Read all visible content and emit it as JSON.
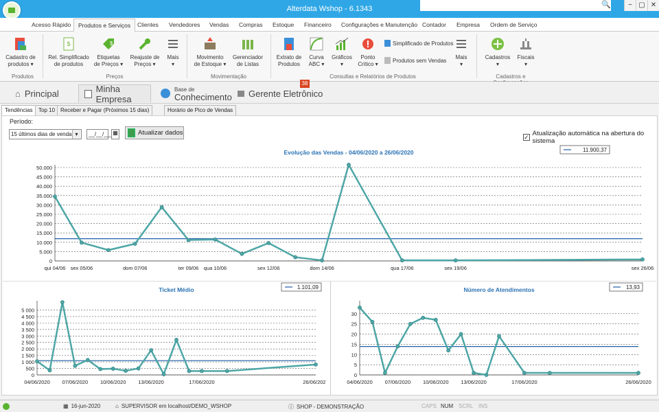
{
  "window": {
    "title": "Alterdata Wshop - 6.1343",
    "buttons": [
      "−",
      "▢",
      "✕"
    ]
  },
  "ribbon_tabs": [
    "Acesso Rápido",
    "Produtos e Serviços",
    "Clientes",
    "Vendedores",
    "Vendas",
    "Compras",
    "Estoque",
    "Financeiro",
    "Configurações e Manutenção",
    "Contador",
    "Empresa",
    "Ordem de Serviço"
  ],
  "ribbon": {
    "cadastro_produtos": "Cadastro de\nprodutos ▾",
    "rel_simplificado": "Rel. Simplificado\nde produtos",
    "etiquetas": "Etiquetas\nde Preços ▾",
    "reajuste": "Reajuste de\nPreços ▾",
    "mais1": "Mais\n▾",
    "movimento": "Movimento\nde Estoque ▾",
    "gerenciador": "Gerenciador\nde Listas",
    "extrato": "Extrato de\nProdutos",
    "curva": "Curva\nABC ▾",
    "graficos": "Gráficos\n▾",
    "ponto_critico": "Ponto\nCrítico ▾",
    "simplificado_produtos": "Simplificado de Produtos",
    "produtos_sem_vendas": "Produtos sem Vendas",
    "mais2": "Mais\n▾",
    "cadastros": "Cadastros\n▾",
    "fiscais": "Fiscais\n▾",
    "groups": [
      "Produtos",
      "Preços",
      "Movimentação",
      "Consultas e Relatórios de Produtos",
      "Cadastros e Configurações"
    ]
  },
  "nav": {
    "principal": "Principal",
    "minha_empresa": "Minha Empresa",
    "base_small": "Base de",
    "base_big": "Conhecimento",
    "gerente": "Gerente Eletrônico",
    "badge": "38"
  },
  "subtabs": [
    "Tendências",
    "Top 10",
    "Receber e Pagar (Próximos 15 dias)",
    "Horário de Pico de Vendas"
  ],
  "filters": {
    "periodo_label": "Período:",
    "periodo_value": "15 últimos dias de vendas",
    "date_value": "__/__/____",
    "update_button": "Atualizar dados",
    "auto_update": "Atualização automática na abertura do sistema"
  },
  "status": {
    "date": "16-jun-2020",
    "user": "SUPERVISOR em localhost/DEMO_WSHOP",
    "shop": "SHOP - DEMONSTRAÇÃO",
    "keys": [
      "CAPS",
      "NUM",
      "SCRL",
      "INS"
    ]
  },
  "chart_data": [
    {
      "type": "line",
      "title": "Evolução das Vendas - 04/06/2020 a 26/06/2020",
      "legend": "11.900,37",
      "avg": 11900.37,
      "ylim": [
        0,
        50000
      ],
      "yticks": [
        "0",
        "5.000",
        "10.000",
        "15.000",
        "20.000",
        "25.000",
        "30.000",
        "35.000",
        "40.000",
        "45.000",
        "50.000"
      ],
      "x_labels": [
        "qui 04/06",
        "sex 05/06",
        "dom 07/06",
        "ter 09/06",
        "qua 10/06",
        "sex 12/06",
        "dom 14/06",
        "qua 17/06",
        "sex 19/06",
        "sex 26/06"
      ],
      "x": [
        0,
        1,
        2,
        3,
        4,
        5,
        6,
        7,
        8,
        9,
        10,
        11,
        13,
        15,
        22
      ],
      "y": [
        34500,
        9800,
        5800,
        9200,
        28800,
        11200,
        11500,
        3800,
        9600,
        2000,
        300,
        51500,
        300,
        300,
        800
      ]
    },
    {
      "type": "line",
      "title": "Ticket Médio",
      "legend": "1.101,09",
      "avg": 1101.09,
      "ylim": [
        0,
        5500
      ],
      "yticks": [
        "0",
        "500",
        "1 000",
        "1 500",
        "2 000",
        "2 500",
        "3 000",
        "3 500",
        "4 000",
        "4 500",
        "5 000"
      ],
      "x_labels": [
        "04/06/2020",
        "07/06/2020",
        "10/06/2020",
        "13/06/2020",
        "17/06/2020",
        "26/06/2020"
      ],
      "x": [
        0,
        1,
        2,
        3,
        4,
        5,
        6,
        7,
        8,
        9,
        10,
        11,
        12,
        13,
        15,
        22
      ],
      "y": [
        1050,
        350,
        5600,
        700,
        1150,
        450,
        480,
        320,
        500,
        1900,
        50,
        2700,
        300,
        300,
        300,
        800
      ]
    },
    {
      "type": "line",
      "title": "Número de Atendimentos",
      "legend": "13,93",
      "avg": 13.93,
      "ylim": [
        0,
        35
      ],
      "yticks": [
        "0",
        "5",
        "10",
        "15",
        "20",
        "25",
        "30"
      ],
      "x_labels": [
        "04/06/2020",
        "07/06/2020",
        "10/06/2020",
        "13/06/2020",
        "17/06/2020",
        "26/06/2020"
      ],
      "x": [
        0,
        1,
        2,
        3,
        4,
        5,
        6,
        7,
        8,
        9,
        10,
        11,
        13,
        15,
        22
      ],
      "y": [
        33,
        26,
        1,
        14,
        25,
        28,
        27,
        12,
        20,
        1,
        0,
        19,
        1,
        1,
        1
      ]
    }
  ]
}
